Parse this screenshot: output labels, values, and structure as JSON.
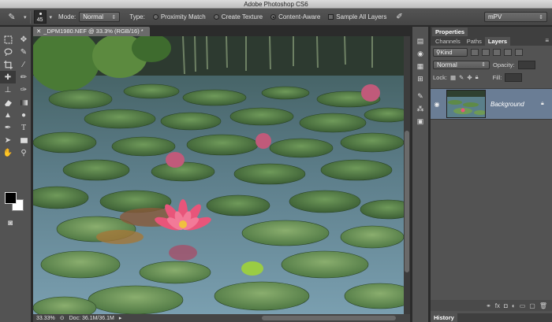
{
  "app": {
    "title": "Adobe Photoshop CS6"
  },
  "options": {
    "brush_size": "45",
    "mode_label": "Mode:",
    "mode_value": "Normal",
    "type_label": "Type:",
    "type_options": [
      {
        "label": "Proximity Match",
        "selected": false
      },
      {
        "label": "Create Texture",
        "selected": false
      },
      {
        "label": "Content-Aware",
        "selected": true
      }
    ],
    "sample_all_layers": "Sample All Layers",
    "workspace": "mPV"
  },
  "document": {
    "tab_title": "_DPM1980.NEF @ 33.3% (RGB/16) *",
    "zoom": "33.33%",
    "doc_size": "Doc: 36.1M/36.1M"
  },
  "panels": {
    "top_tabs": [
      "Properties"
    ],
    "layer_tabs": [
      "Channels",
      "Paths",
      "Layers"
    ],
    "active_layer_tab": "Layers",
    "kind_label": "Kind",
    "blend_mode": "Normal",
    "opacity_label": "Opacity:",
    "lock_label": "Lock:",
    "fill_label": "Fill:",
    "layer_name": "Background",
    "history_tab": "History"
  },
  "colors": {
    "foreground": "#000000",
    "background": "#ffffff",
    "selected_layer": "#6a7d95"
  }
}
